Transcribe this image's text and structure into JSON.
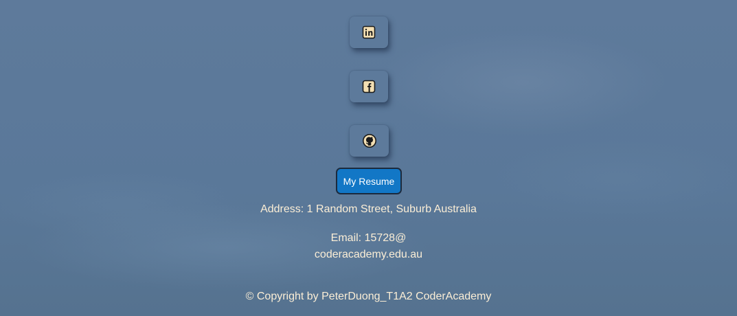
{
  "social": {
    "items": [
      {
        "icon": "linkedin-icon"
      },
      {
        "icon": "facebook-icon"
      },
      {
        "icon": "github-icon"
      }
    ]
  },
  "resume": {
    "label": "My Resume"
  },
  "contact": {
    "address": "Address: 1 Random Street, Suburb Australia",
    "email_line1": "Email: 15728@",
    "email_line2": "coderacademy.edu.au"
  },
  "footer": {
    "copyright": "© Copyright by PeterDuong_T1A2 CoderAcademy"
  },
  "colors": {
    "background": "#5b7899",
    "icon_fill": "#f3dfb3",
    "icon_stroke": "#1b1b1b",
    "resume_button": "#1277c6",
    "text": "#fbeed6"
  }
}
